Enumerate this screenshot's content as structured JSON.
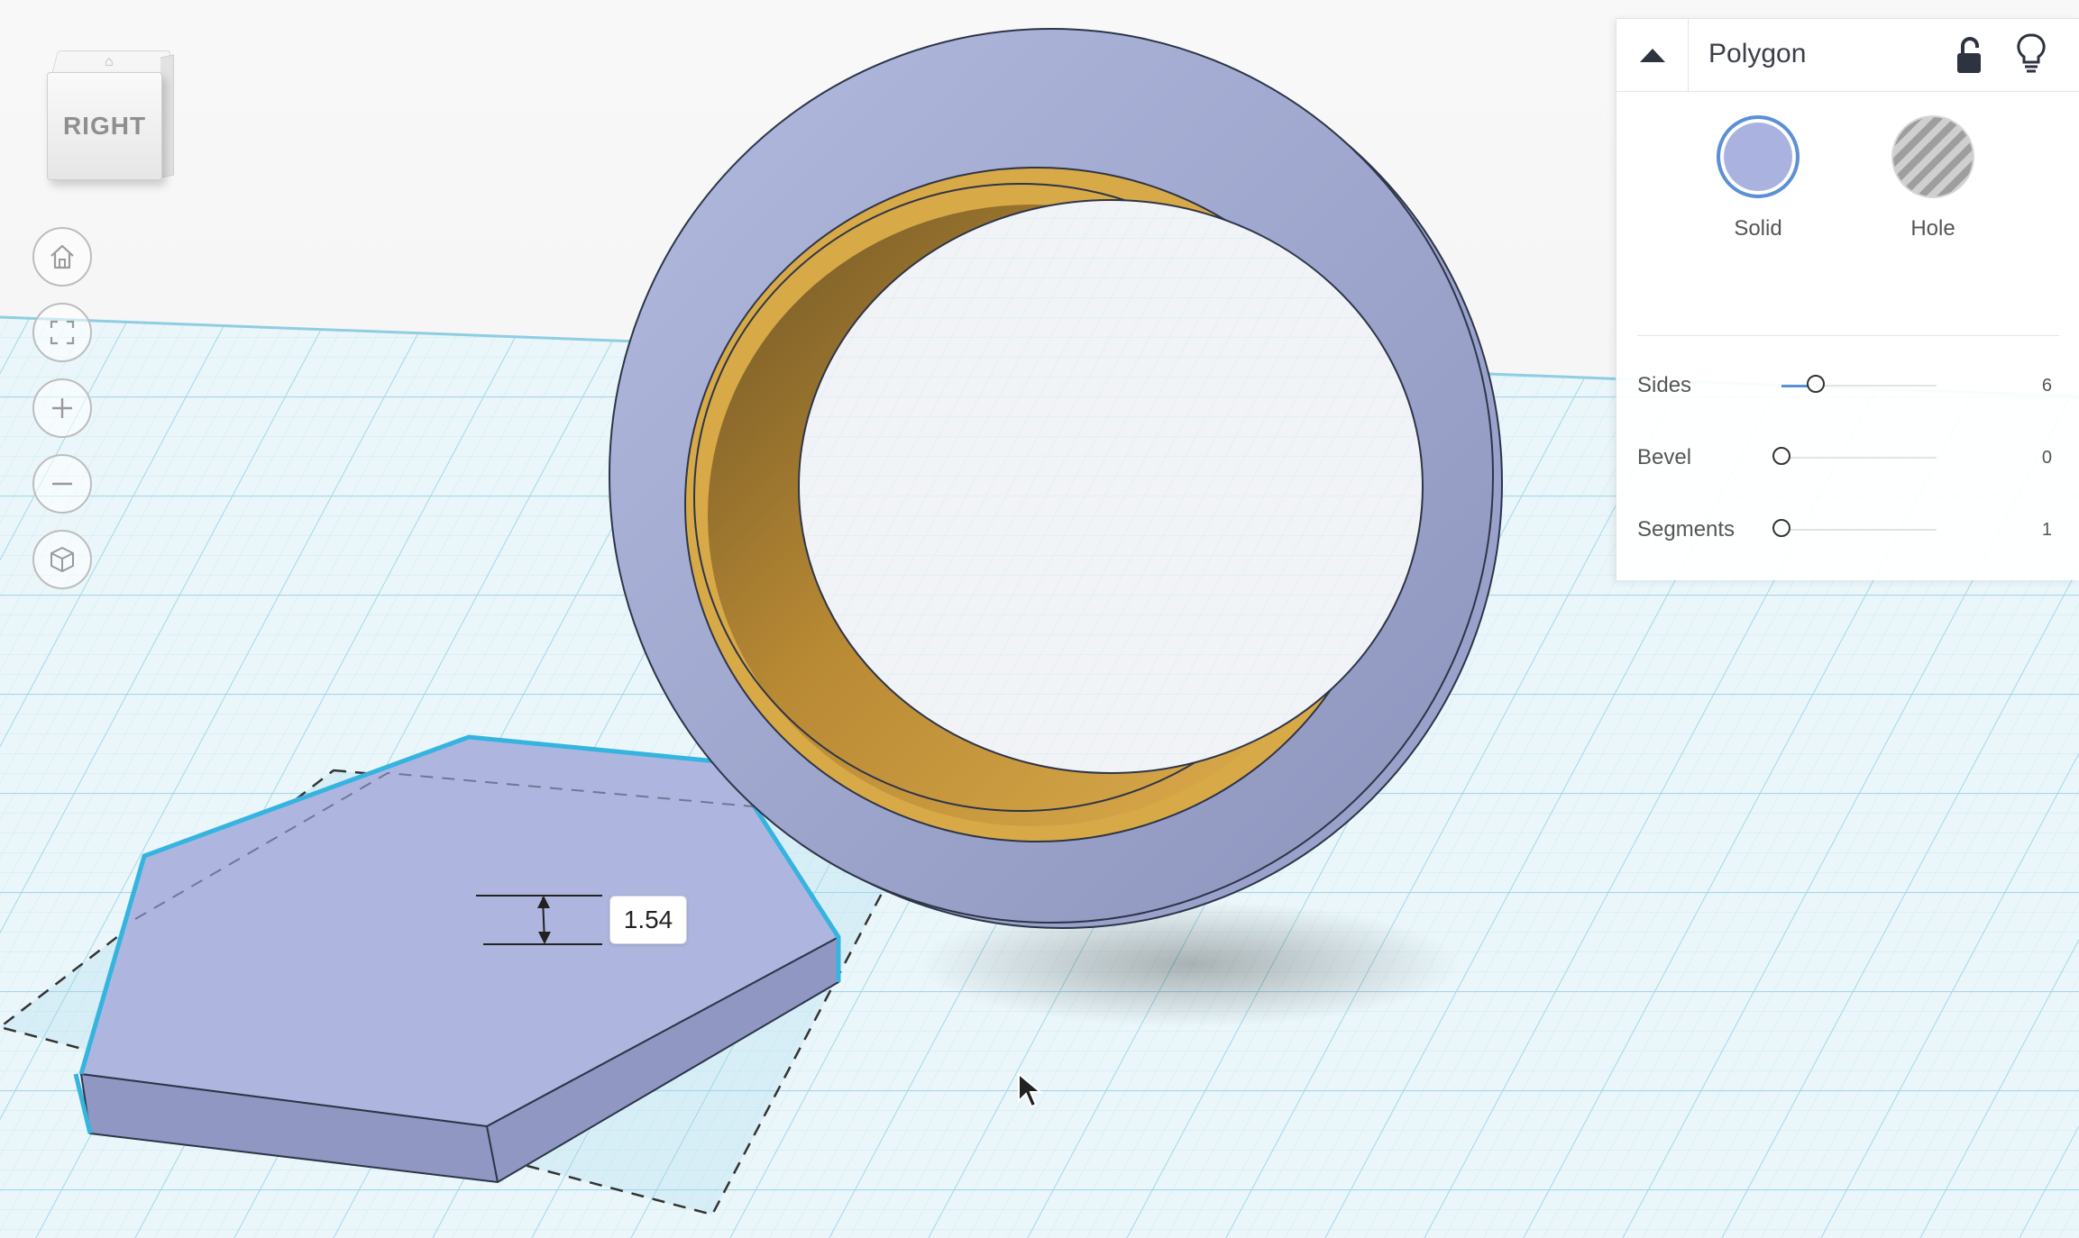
{
  "viewcube": {
    "face_label": "RIGHT",
    "top_icon": "viewcube-top-icon"
  },
  "nav_controls": [
    {
      "name": "home-view-button",
      "icon": "home-icon"
    },
    {
      "name": "fit-view-button",
      "icon": "fit-view-icon"
    },
    {
      "name": "zoom-in-button",
      "icon": "plus-icon"
    },
    {
      "name": "zoom-out-button",
      "icon": "minus-icon"
    },
    {
      "name": "perspective-button",
      "icon": "cube-icon"
    }
  ],
  "canvas": {
    "dimension_value": "1.54",
    "colors": {
      "solid": "#aab3e0",
      "ring_inner": "#d9a94a",
      "grid": "#bfe3ee",
      "selection": "#3cb7dd"
    }
  },
  "inspector": {
    "title": "Polygon",
    "modes": {
      "solid_label": "Solid",
      "hole_label": "Hole",
      "selected": "Solid"
    },
    "properties": [
      {
        "label": "Sides",
        "value": "6",
        "fraction": 0.22
      },
      {
        "label": "Bevel",
        "value": "0",
        "fraction": 0.0
      },
      {
        "label": "Segments",
        "value": "1",
        "fraction": 0.0
      }
    ],
    "accent": "#5b8fd6"
  }
}
